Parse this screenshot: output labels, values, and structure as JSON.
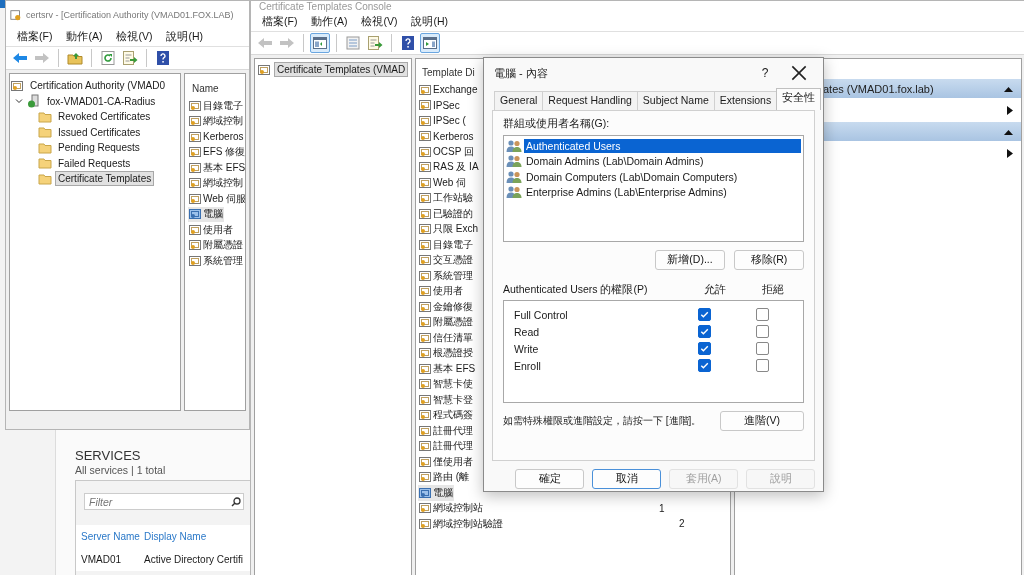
{
  "certsrv_window": {
    "title": "certsrv - [Certification Authority (VMAD01.FOX.LAB)",
    "menu": [
      "檔案(F)",
      "動作(A)",
      "檢視(V)",
      "說明(H)"
    ],
    "toolbar": [
      {
        "kind": "back",
        "disabled": false,
        "pressed": false
      },
      {
        "kind": "forward",
        "disabled": true,
        "pressed": false
      },
      {
        "kind": "separator"
      },
      {
        "kind": "folder-up",
        "disabled": false,
        "pressed": false
      },
      {
        "kind": "separator"
      },
      {
        "kind": "refresh",
        "disabled": false,
        "pressed": false
      },
      {
        "kind": "export",
        "disabled": false,
        "pressed": false
      },
      {
        "kind": "separator"
      },
      {
        "kind": "help",
        "disabled": false,
        "pressed": false
      }
    ],
    "tree": {
      "label": "Certification Authority (VMAD0",
      "children": [
        {
          "label": "fox-VMAD01-CA-Radius",
          "expanded": true,
          "children": [
            {
              "label": "Revoked Certificates",
              "selected": false
            },
            {
              "label": "Issued Certificates",
              "selected": false
            },
            {
              "label": "Pending Requests",
              "selected": false
            },
            {
              "label": "Failed Requests",
              "selected": false
            },
            {
              "label": "Certificate Templates",
              "selected": true
            }
          ]
        }
      ]
    },
    "list": {
      "column": "Name",
      "items": [
        {
          "label": "目錄電子",
          "selected": false
        },
        {
          "label": "網域控制",
          "selected": false
        },
        {
          "label": "Kerberos",
          "selected": false
        },
        {
          "label": "EFS 修復",
          "selected": false
        },
        {
          "label": "基本 EFS",
          "selected": false
        },
        {
          "label": "網域控制",
          "selected": false
        },
        {
          "label": "Web 伺服",
          "selected": false
        },
        {
          "label": "電腦",
          "selected": true
        },
        {
          "label": "使用者",
          "selected": false
        },
        {
          "label": "附屬憑證",
          "selected": false
        },
        {
          "label": "系統管理",
          "selected": false
        }
      ]
    }
  },
  "templates_console": {
    "title": "Certificate Templates Console",
    "menu": [
      "檔案(F)",
      "動作(A)",
      "檢視(V)",
      "說明(H)"
    ],
    "toolbar": [
      {
        "kind": "back",
        "disabled": true,
        "pressed": false
      },
      {
        "kind": "forward",
        "disabled": true,
        "pressed": false
      },
      {
        "kind": "separator"
      },
      {
        "kind": "tree-toggle",
        "disabled": false,
        "pressed": true
      },
      {
        "kind": "separator"
      },
      {
        "kind": "properties",
        "disabled": false,
        "pressed": false
      },
      {
        "kind": "export",
        "disabled": false,
        "pressed": false
      },
      {
        "kind": "separator"
      },
      {
        "kind": "help",
        "disabled": false,
        "pressed": false
      },
      {
        "kind": "action-pane",
        "disabled": false,
        "pressed": true
      }
    ],
    "tree": [
      {
        "label": "Certificate Templates (VMAD",
        "selected": true
      }
    ],
    "list": {
      "column": "Template Di",
      "rows": [
        {
          "name": "Exchange",
          "selected": false
        },
        {
          "name": "IPSec",
          "selected": false
        },
        {
          "name": "IPSec (",
          "selected": false
        },
        {
          "name": "Kerberos",
          "selected": false
        },
        {
          "name": "OCSP 回",
          "selected": false
        },
        {
          "name": "RAS 及 IA",
          "selected": false
        },
        {
          "name": "Web 伺",
          "selected": false
        },
        {
          "name": "工作站驗",
          "selected": false
        },
        {
          "name": "已驗證的",
          "selected": false
        },
        {
          "name": "只限 Exch",
          "selected": false
        },
        {
          "name": "目錄電子",
          "selected": false
        },
        {
          "name": "交互憑證",
          "selected": false
        },
        {
          "name": "系統管理",
          "selected": false
        },
        {
          "name": "使用者",
          "selected": false
        },
        {
          "name": "金鑰修復",
          "selected": false
        },
        {
          "name": "附屬憑證",
          "selected": false
        },
        {
          "name": "信任清單",
          "selected": false
        },
        {
          "name": "根憑證授",
          "selected": false
        },
        {
          "name": "基本 EFS",
          "selected": false
        },
        {
          "name": "智慧卡使",
          "selected": false
        },
        {
          "name": "智慧卡登",
          "selected": false
        },
        {
          "name": "程式碼簽",
          "selected": false
        },
        {
          "name": "註冊代理",
          "selected": false
        },
        {
          "name": "註冊代理",
          "selected": false
        },
        {
          "name": "僅使用者",
          "selected": false
        },
        {
          "name": "路由 (離",
          "selected": false
        },
        {
          "name": "電腦",
          "selected": true
        },
        {
          "name": "網域控制站",
          "column_2": "1",
          "selected": false
        },
        {
          "name": "網域控制站驗證",
          "column_2": "2",
          "selected": false
        }
      ]
    },
    "actions": [
      {
        "title": "ates (VMAD01.fox.lab)",
        "expanded": true
      },
      {
        "expanded": true
      }
    ]
  },
  "dialog": {
    "title": "電腦 - 內容",
    "help_glyph": "?",
    "tabs": [
      {
        "label": "General",
        "selected": false
      },
      {
        "label": "Request Handling",
        "selected": false
      },
      {
        "label": "Subject Name",
        "selected": false
      },
      {
        "label": "Extensions",
        "selected": false
      },
      {
        "label": "安全性",
        "selected": true
      }
    ],
    "groups_label": "群組或使用者名稱(G):",
    "groups": [
      {
        "name": "Authenticated Users",
        "selected": true
      },
      {
        "name": "Domain Admins (Lab\\Domain Admins)",
        "selected": false
      },
      {
        "name": "Domain Computers (Lab\\Domain Computers)",
        "selected": false
      },
      {
        "name": "Enterprise Admins (Lab\\Enterprise Admins)",
        "selected": false
      }
    ],
    "group_buttons": [
      "新增(D)...",
      "移除(R)"
    ],
    "permissions_label": "Authenticated Users 的權限(P)",
    "allow_label": "允許",
    "deny_label": "拒絕",
    "permissions": [
      {
        "name": "Full Control",
        "allow": true,
        "deny": false
      },
      {
        "name": "Read",
        "allow": true,
        "deny": false
      },
      {
        "name": "Write",
        "allow": true,
        "deny": false
      },
      {
        "name": "Enroll",
        "allow": true,
        "deny": false
      }
    ],
    "advanced_hint": "如需特殊權限或進階設定，請按一下 [進階]。",
    "advanced_button": "進階(V)",
    "buttons": [
      {
        "label": "確定",
        "default": false,
        "disabled": false
      },
      {
        "label": "取消",
        "default": true,
        "disabled": false
      },
      {
        "label": "套用(A)",
        "default": false,
        "disabled": true
      },
      {
        "label": "說明",
        "default": false,
        "disabled": true
      }
    ]
  },
  "services": {
    "title": "SERVICES",
    "subtitle": "All services | 1 total",
    "filter": {
      "placeholder": "Filter"
    },
    "columns": [
      "Server Name",
      "Display Name"
    ],
    "rows": [
      [
        "VMAD01",
        "Active Directory Certifi"
      ]
    ]
  }
}
